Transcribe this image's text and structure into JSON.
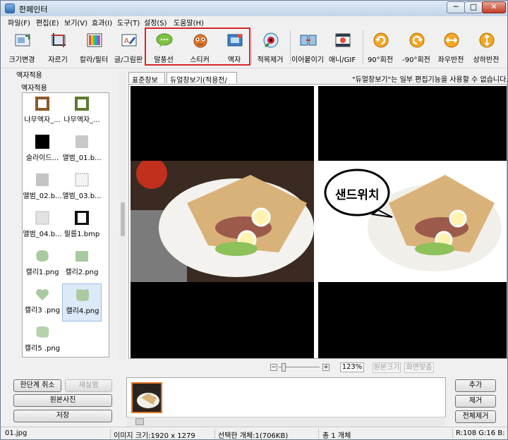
{
  "window": {
    "title": "한페인터",
    "min": "─",
    "max": "□",
    "close": "✕"
  },
  "menu": [
    "파일(F)",
    "편집(E)",
    "보기(V)",
    "효과(I)",
    "도구(T)",
    "설정(S)",
    "도움말(H)"
  ],
  "toolbar": [
    {
      "label": "크기변경",
      "icon": "resize-icon"
    },
    {
      "label": "자르기",
      "icon": "crop-icon"
    },
    {
      "label": "칼라/필터",
      "icon": "color-filter-icon"
    },
    {
      "label": "글/그림판",
      "icon": "text-paint-icon"
    },
    {
      "label": "말풍선",
      "icon": "speech-bubble-icon"
    },
    {
      "label": "스티커",
      "icon": "sticker-icon"
    },
    {
      "label": "액자",
      "icon": "frame-icon"
    },
    {
      "label": "적목제거",
      "icon": "red-eye-icon"
    },
    {
      "label": "이어붙이기",
      "icon": "merge-icon"
    },
    {
      "label": "애니/GIF",
      "icon": "gif-icon"
    },
    {
      "label": "90°회전",
      "icon": "rotate-cw-icon"
    },
    {
      "label": "-90°회전",
      "icon": "rotate-ccw-icon"
    },
    {
      "label": "좌우반전",
      "icon": "flip-horizontal-icon"
    },
    {
      "label": "상하반전",
      "icon": "flip-vertical-icon"
    }
  ],
  "left_panel": {
    "heading": "액자적용",
    "subheading": "액자적용",
    "frames": [
      "나무액자_...",
      "나무액자_...",
      "슬라이드...",
      "앨범_01.b...",
      "앨범_02.b...",
      "앨범_03.b...",
      "앨범_04.b...",
      "필름1.bmp",
      "캘리1.png",
      "캘리2.png",
      "캘리3 .png",
      "캘리4.png",
      "캘리5 .png"
    ],
    "selected_index": 11
  },
  "tabs": {
    "standard": "표준창보기",
    "dual": "듀얼창보기(적용전/후)"
  },
  "notice": "\"듀얼창보기\"는 일부 편집기능을 사용할 수 없습니다.",
  "preview": {
    "bubble_text": "샌드위치"
  },
  "zoom": {
    "minus": "−",
    "plus": "+",
    "value": "123%",
    "original_size": "원본크기",
    "fit_screen": "화면맞춤"
  },
  "left_buttons": {
    "undo": "한단계 취소",
    "redo": "재실행",
    "original": "원본사진",
    "save": "저장"
  },
  "right_buttons": {
    "add": "추가",
    "remove": "제거",
    "remove_all": "전체제거"
  },
  "status": {
    "file": "01.jpg",
    "image_size": "이미지 크기:1920 x 1279",
    "selected": "선택한 개체:1(706KB)",
    "total": "총 1 개체",
    "rgb": "R:108 G:16 B:"
  },
  "colors": {
    "highlight": "#d9242b",
    "filmstrip_border": "#e8792a",
    "selection": "#dce9f8"
  }
}
